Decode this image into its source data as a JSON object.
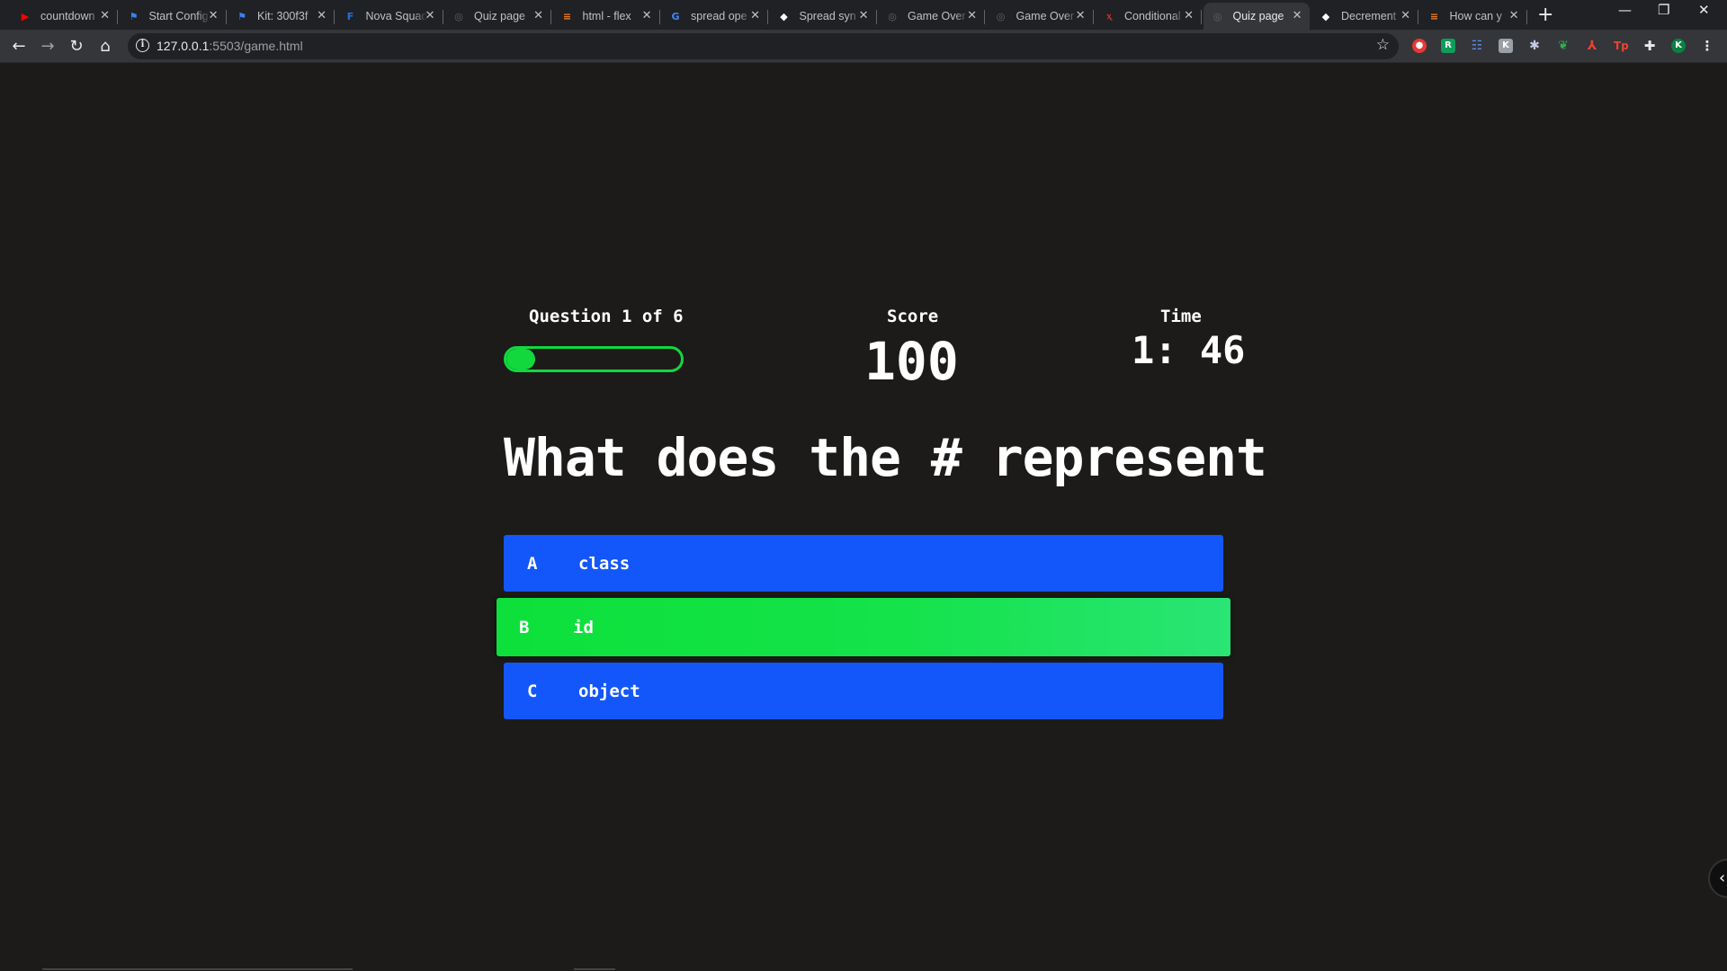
{
  "browser": {
    "tabs": [
      {
        "title": "countdown",
        "icon": "youtube-icon",
        "color": "#ff0000",
        "glyph": "▶"
      },
      {
        "title": "Start Config",
        "icon": "flag-icon",
        "color": "#3b82f6",
        "glyph": "⚑"
      },
      {
        "title": "Kit: 300f3f",
        "icon": "flag-icon",
        "color": "#3b82f6",
        "glyph": "⚑"
      },
      {
        "title": "Nova Squad",
        "icon": "nova-icon",
        "color": "#1a73e8",
        "glyph": "F"
      },
      {
        "title": "Quiz page",
        "icon": "globe-icon",
        "color": "#5f6368",
        "glyph": "◎"
      },
      {
        "title": "html - flex",
        "icon": "stackoverflow-icon",
        "color": "#f48024",
        "glyph": "≡"
      },
      {
        "title": "spread ope",
        "icon": "google-icon",
        "color": "#4285f4",
        "glyph": "G"
      },
      {
        "title": "Spread syn",
        "icon": "mdn-icon",
        "color": "#ffffff",
        "glyph": "◆"
      },
      {
        "title": "Game Over",
        "icon": "globe-icon",
        "color": "#5f6368",
        "glyph": "◎"
      },
      {
        "title": "Game Over",
        "icon": "globe-icon",
        "color": "#5f6368",
        "glyph": "◎"
      },
      {
        "title": "Conditional",
        "icon": "w3-icon",
        "color": "#d93025",
        "glyph": "ⲭ"
      },
      {
        "title": "Quiz page",
        "icon": "globe-icon",
        "color": "#5f6368",
        "glyph": "◎",
        "active": true
      },
      {
        "title": "Decrement",
        "icon": "mdn-icon",
        "color": "#ffffff",
        "glyph": "◆"
      },
      {
        "title": "How can y",
        "icon": "stackoverflow-icon",
        "color": "#f48024",
        "glyph": "≡"
      }
    ],
    "url_host": "127.0.0.1",
    "url_rest": ":5503/game.html",
    "profile_initial": "K"
  },
  "hud": {
    "question_label": "Question 1 of 6",
    "progress_fraction": 0.1667,
    "score_label": "Score",
    "score_value": "100",
    "time_label": "Time",
    "time_value": "1: 46"
  },
  "question": "What does the # represent",
  "choices": [
    {
      "prefix": "A",
      "text": "class",
      "state": "default"
    },
    {
      "prefix": "B",
      "text": "id",
      "state": "correct"
    },
    {
      "prefix": "C",
      "text": "object",
      "state": "default"
    }
  ],
  "colors": {
    "background": "#1c1b19",
    "choice": "#1357fa",
    "correct": "#12d83e",
    "progress": "#12d83e"
  }
}
